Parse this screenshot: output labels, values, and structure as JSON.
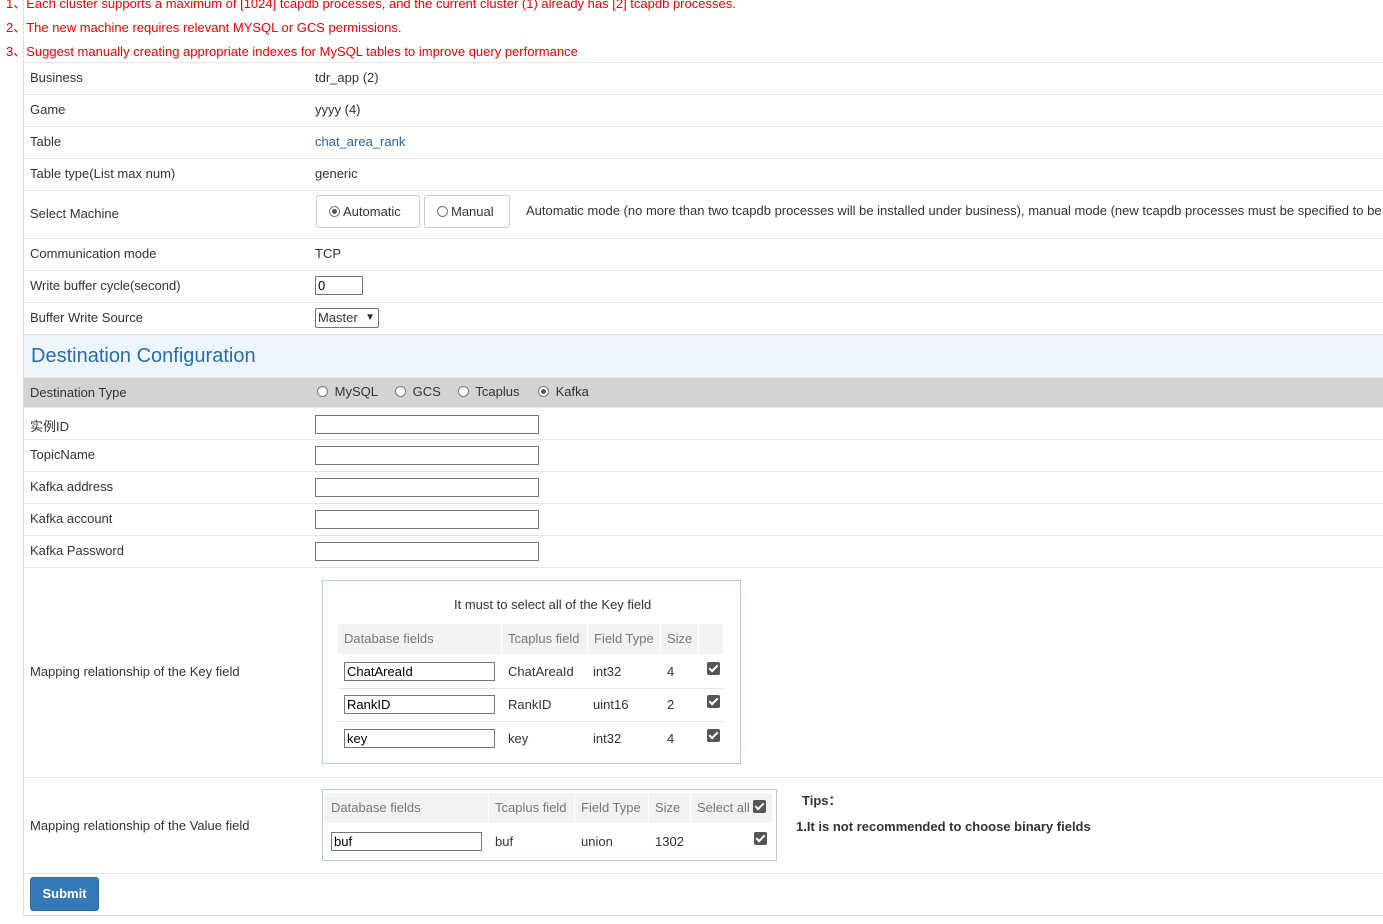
{
  "notices": [
    "1、Each cluster supports a maximum of [1024] tcapdb processes, and the current cluster (1) already has [2] tcapdb processes.",
    "2、The new machine requires relevant MYSQL or GCS permissions.",
    "3、Suggest manually creating appropriate indexes for MySQL tables to improve query performance"
  ],
  "info": {
    "business_label": "Business",
    "business_value": "tdr_app (2)",
    "game_label": "Game",
    "game_value": "yyyy (4)",
    "table_label": "Table",
    "table_value": "chat_area_rank",
    "table_type_label": "Table type(List max num)",
    "table_type_value": "generic",
    "select_machine_label": "Select Machine",
    "machine_modes": [
      "Automatic",
      "Manual"
    ],
    "machine_selected": "Automatic",
    "machine_hint": "Automatic mode (no more than two tcapdb processes will be installed under business), manual mode (new tcapdb processes must be specified to be installed",
    "comm_label": "Communication mode",
    "comm_value": "TCP",
    "write_cycle_label": "Write buffer cycle(second)",
    "write_cycle_value": "0",
    "buffer_source_label": "Buffer Write Source",
    "buffer_source_value": "Master"
  },
  "destination": {
    "heading": "Destination Configuration",
    "type_label": "Destination Type",
    "types": [
      "MySQL",
      "GCS",
      "Tcaplus",
      "Kafka"
    ],
    "selected_type": "Kafka",
    "instance_label": "实例ID",
    "topic_label": "TopicName",
    "address_label": "Kafka address",
    "account_label": "Kafka account",
    "password_label": "Kafka Password"
  },
  "key_mapping": {
    "label": "Mapping relationship of the Key field",
    "caption": "It must to select all of the Key field",
    "headers": [
      "Database fields",
      "Tcaplus field",
      "Field Type",
      "Size"
    ],
    "rows": [
      {
        "db": "ChatAreaId",
        "tcaplus": "ChatAreaId",
        "type": "int32",
        "size": "4",
        "checked": true
      },
      {
        "db": "RankID",
        "tcaplus": "RankID",
        "type": "uint16",
        "size": "2",
        "checked": true
      },
      {
        "db": "key",
        "tcaplus": "key",
        "type": "int32",
        "size": "4",
        "checked": true
      }
    ]
  },
  "value_mapping": {
    "label": "Mapping relationship of the Value field",
    "headers": [
      "Database fields",
      "Tcaplus field",
      "Field Type",
      "Size",
      "Select all"
    ],
    "select_all_checked": true,
    "rows": [
      {
        "db": "buf",
        "tcaplus": "buf",
        "type": "union",
        "size": "1302",
        "checked": true
      }
    ]
  },
  "tips": {
    "title": "Tips：",
    "line1": "1.It is not recommended to choose binary fields"
  },
  "submit_label": "Submit"
}
